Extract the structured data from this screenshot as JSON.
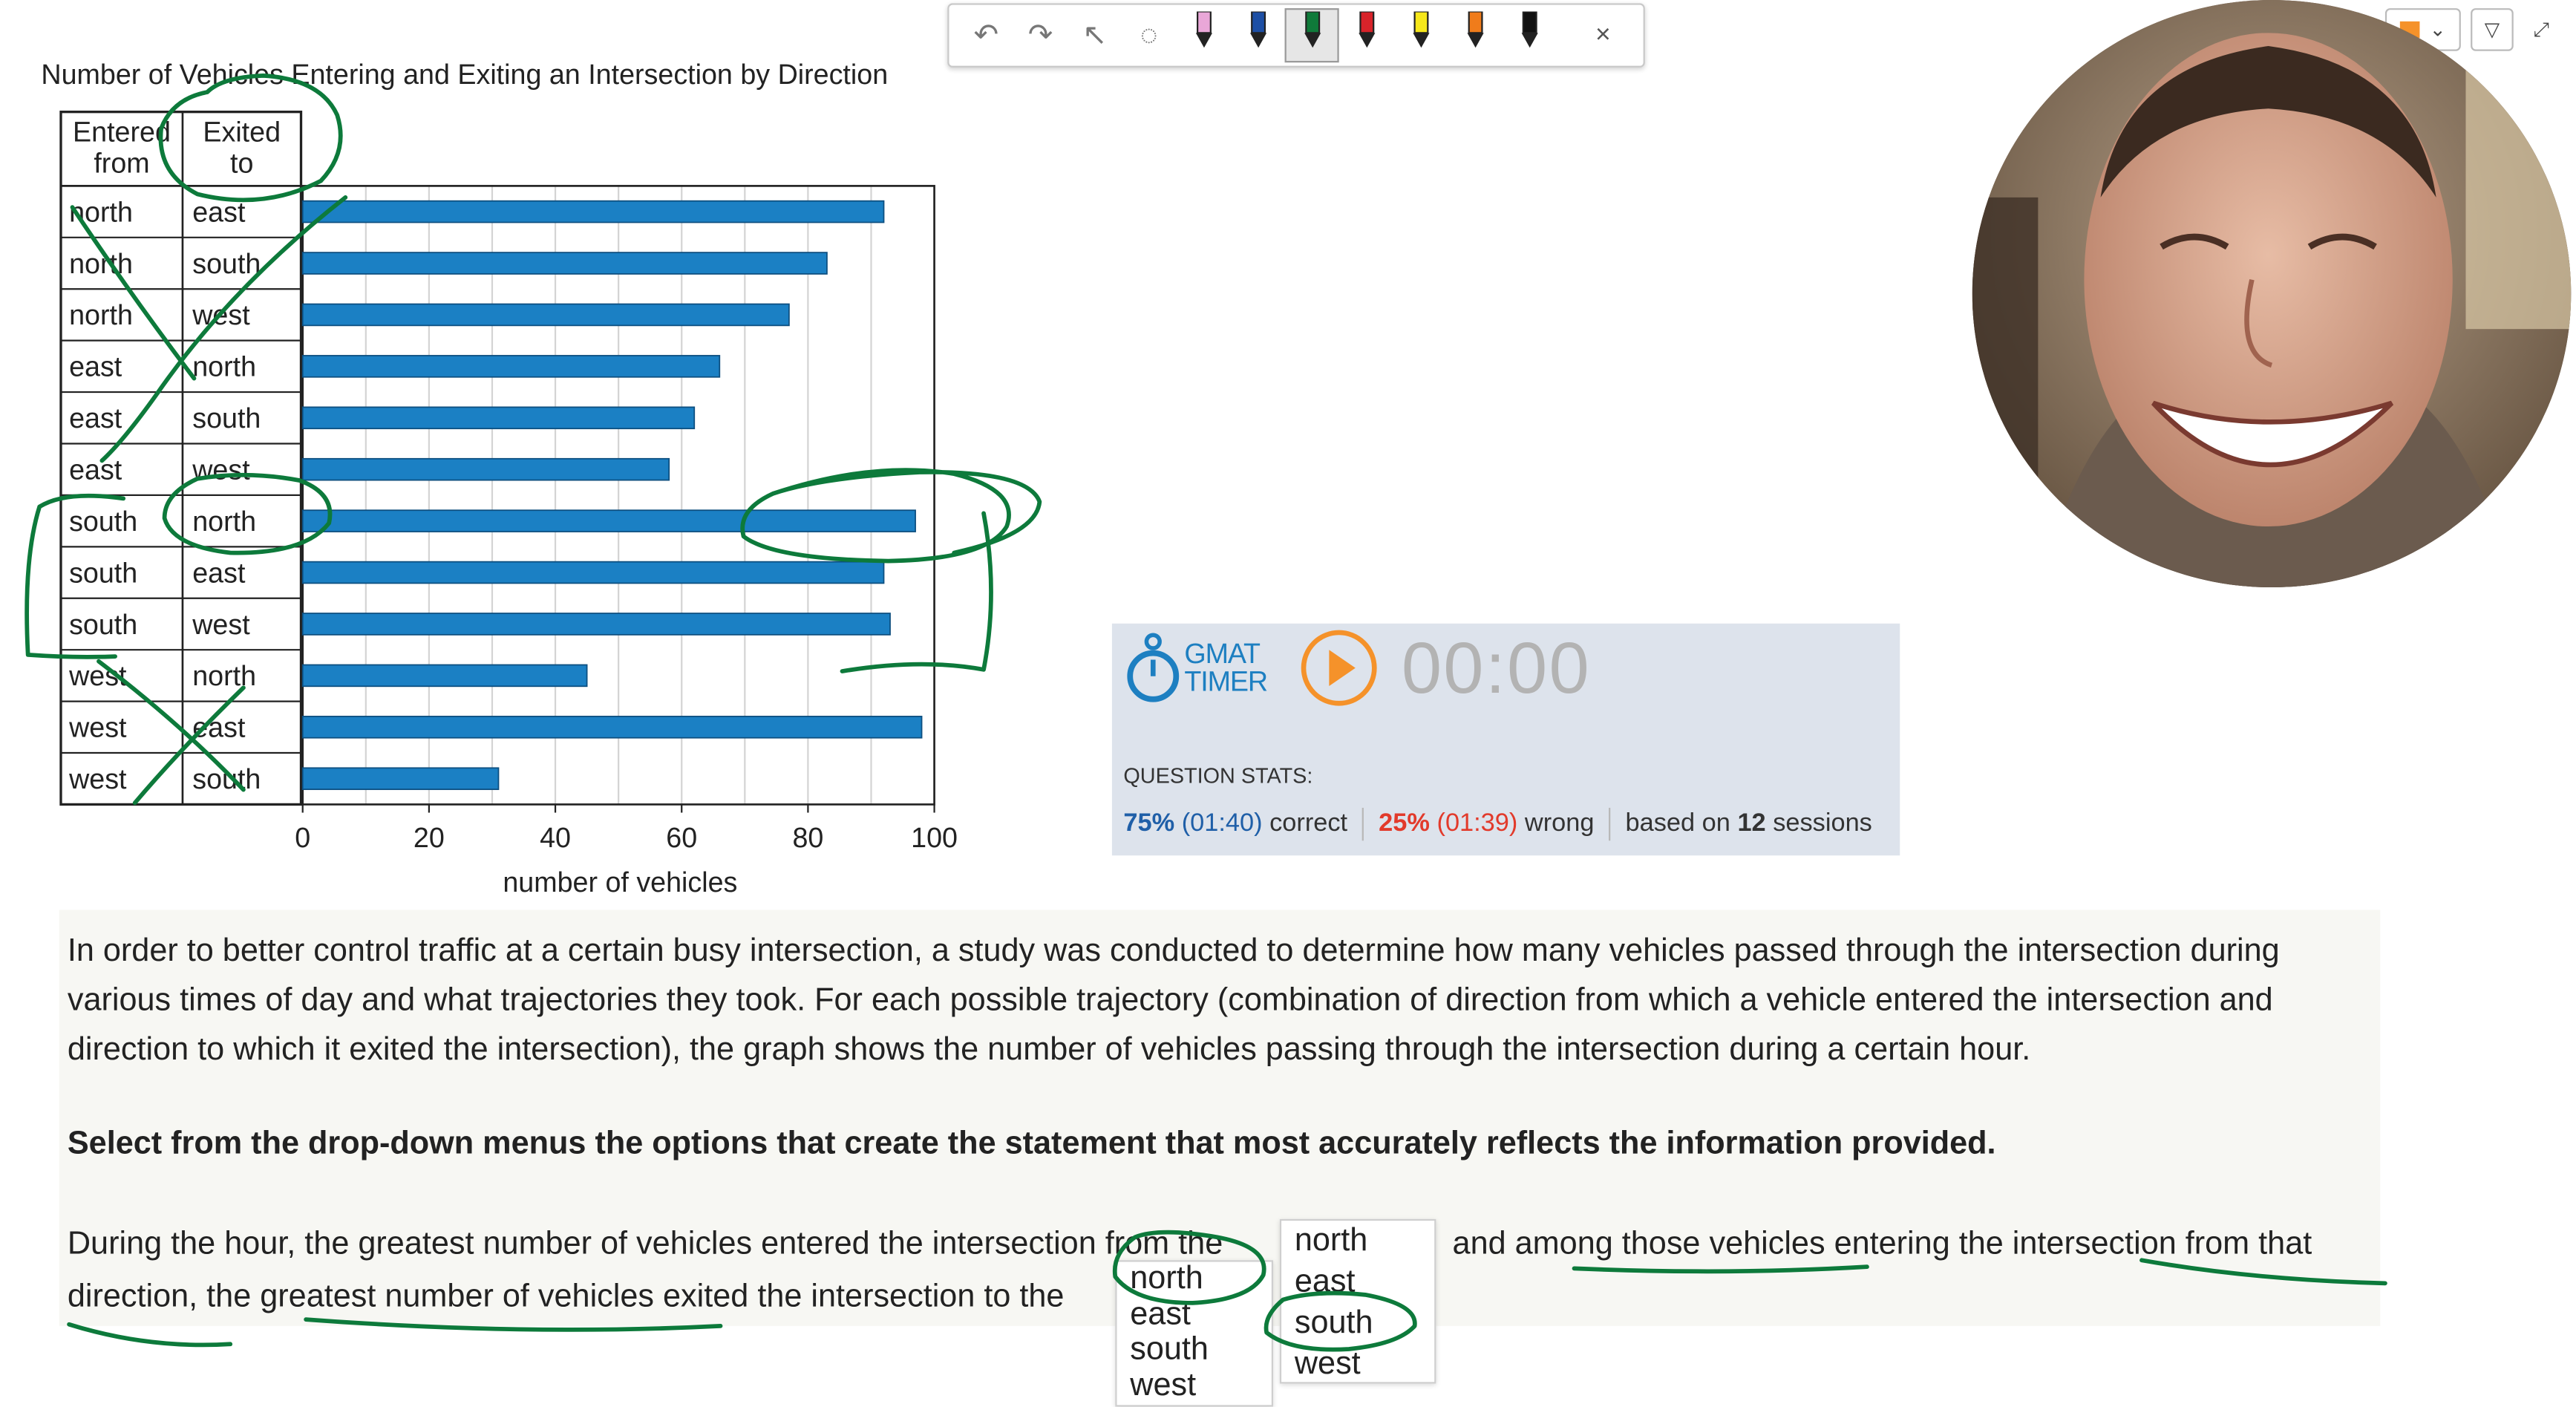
{
  "chart_data": {
    "type": "bar",
    "title": "Number of Vehicles Entering and Exiting an Intersection by Direction",
    "table_headers": [
      "Entered from",
      "Exited to"
    ],
    "categories": [
      {
        "entered": "north",
        "exited": "east"
      },
      {
        "entered": "north",
        "exited": "south"
      },
      {
        "entered": "north",
        "exited": "west"
      },
      {
        "entered": "east",
        "exited": "north"
      },
      {
        "entered": "east",
        "exited": "south"
      },
      {
        "entered": "east",
        "exited": "west"
      },
      {
        "entered": "south",
        "exited": "north"
      },
      {
        "entered": "south",
        "exited": "east"
      },
      {
        "entered": "south",
        "exited": "west"
      },
      {
        "entered": "west",
        "exited": "north"
      },
      {
        "entered": "west",
        "exited": "east"
      },
      {
        "entered": "west",
        "exited": "south"
      }
    ],
    "values": [
      92,
      83,
      77,
      66,
      62,
      58,
      97,
      92,
      93,
      45,
      98,
      31
    ],
    "xlabel": "number of vehicles",
    "xlim": [
      0,
      100
    ],
    "xticks": [
      0,
      20,
      40,
      60,
      80,
      100
    ],
    "grid": "vertical",
    "bar_color": "#1b80c4"
  },
  "toolbar": {
    "tools": [
      {
        "name": "undo-icon",
        "glyph": "↶"
      },
      {
        "name": "redo-icon",
        "glyph": "↷"
      },
      {
        "name": "pointer-icon",
        "glyph": "↖"
      },
      {
        "name": "lasso-icon",
        "glyph": "◌"
      },
      {
        "name": "pen-pink-icon",
        "color": "#e9a7d8"
      },
      {
        "name": "pen-blue-icon",
        "color": "#1d4fa5"
      },
      {
        "name": "pen-green-icon",
        "color": "#0f7a3a"
      },
      {
        "name": "pen-red-icon",
        "color": "#d8232a"
      },
      {
        "name": "highlighter-yellow-icon",
        "color": "#f6e71a"
      },
      {
        "name": "pen-orange-icon",
        "color": "#f07c1b"
      },
      {
        "name": "pen-black-icon",
        "color": "#111111"
      }
    ],
    "close": "×"
  },
  "timer": {
    "brand_top": "GMAT",
    "brand_bottom": "TIMER",
    "time": "00:00",
    "stats_heading": "QUESTION STATS:",
    "correct_pct": "75%",
    "correct_time": "(01:40)",
    "correct_label": "correct",
    "wrong_pct": "25%",
    "wrong_time": "(01:39)",
    "wrong_label": "wrong",
    "sessions_prefix": "based on",
    "sessions_count": "12",
    "sessions_suffix": "sessions"
  },
  "passage": {
    "intro": "In order to better control traffic at a certain busy intersection, a study was conducted to determine how many vehicles passed through the intersection during various times of day and what trajectories they took. For each possible trajectory (combination of direction from which a vehicle entered the intersection and direction to which it exited the intersection), the graph shows the number of vehicles passing through the intersection during a certain hour.",
    "instruction": "Select from the drop-down menus the options that create the statement that most accurately reflects the information provided.",
    "statement_part1": "During the hour, the greatest number of vehicles entered the intersection from the",
    "statement_part2": "and among those vehicles entering the intersection from that",
    "statement_part3": "direction, the greatest number of vehicles exited the intersection to the"
  },
  "dropdown1": {
    "options": [
      "north",
      "east",
      "south",
      "west"
    ]
  },
  "dropdown2": {
    "options": [
      "north",
      "east",
      "south",
      "west"
    ]
  },
  "colors": {
    "ink": "#0d7a3b",
    "accent_orange": "#f5922a",
    "brand_blue": "#1d7fc1"
  }
}
